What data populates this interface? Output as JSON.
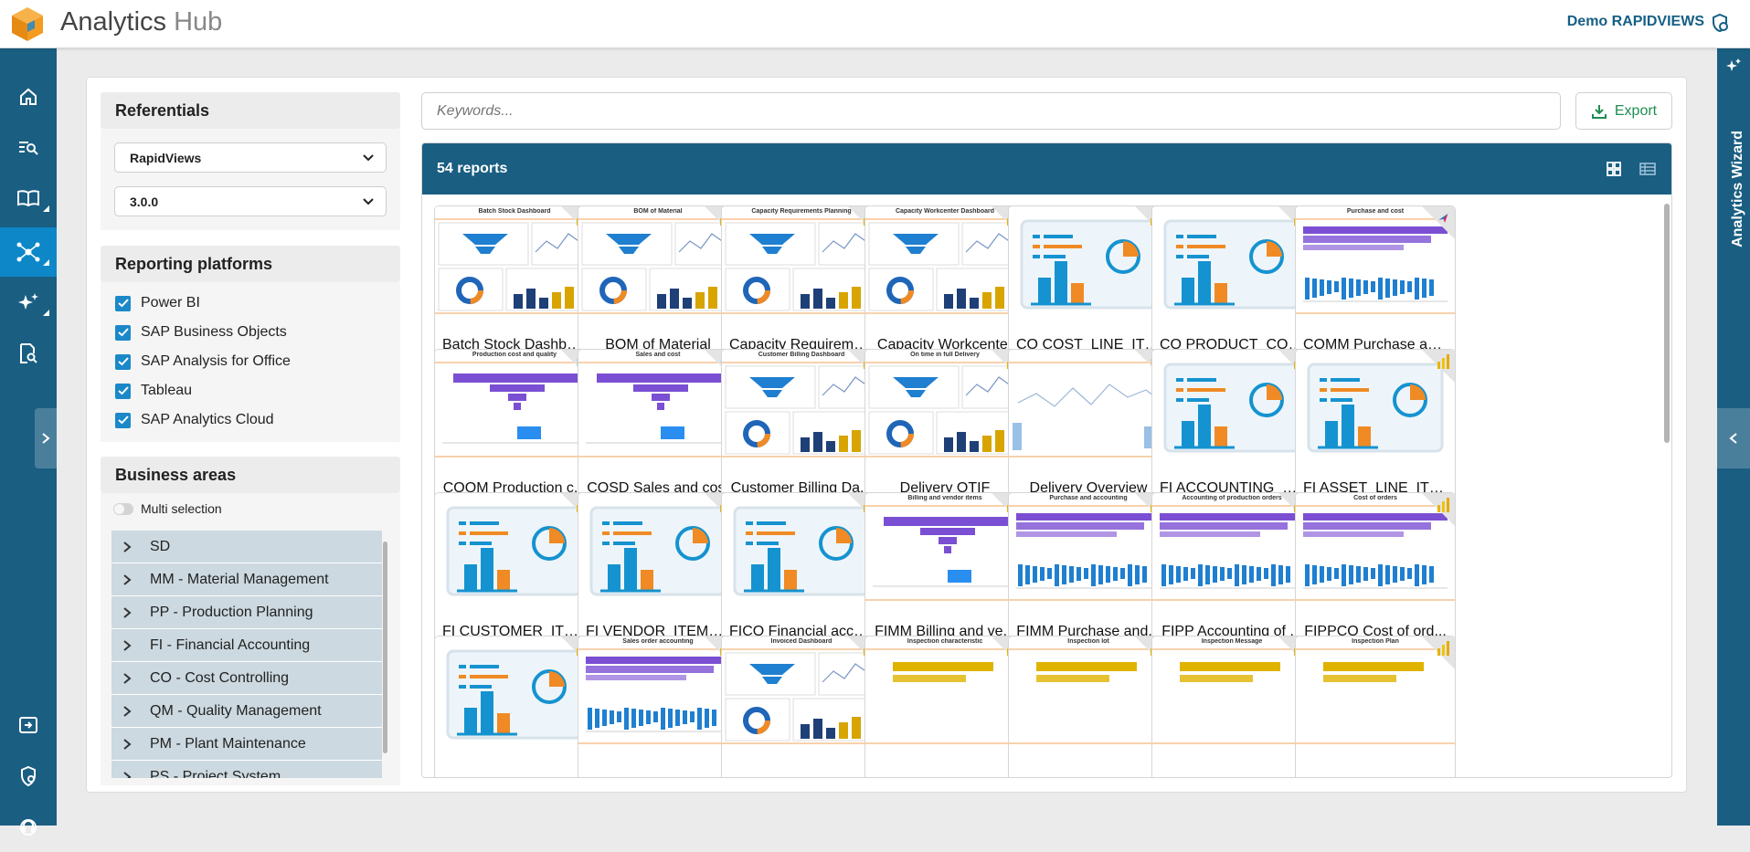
{
  "app": {
    "title_main": "Analytics",
    "title_sub": "Hub",
    "user": "Demo RAPIDVIEWS",
    "wizard": "Analytics Wizard"
  },
  "nav": {
    "items": [
      "home-icon",
      "search-list-icon",
      "book-icon",
      "network-icon",
      "sparkle-icon",
      "report-search-icon"
    ],
    "bottom": [
      "import-icon",
      "settings-icon",
      "support-icon"
    ],
    "active": "network-icon"
  },
  "referentials": {
    "title": "Referentials",
    "source": "RapidViews",
    "version": "3.0.0"
  },
  "platforms": {
    "title": "Reporting platforms",
    "items": [
      {
        "label": "Power BI",
        "checked": true
      },
      {
        "label": "SAP Business Objects",
        "checked": true
      },
      {
        "label": "SAP Analysis for Office",
        "checked": true
      },
      {
        "label": "Tableau",
        "checked": true
      },
      {
        "label": "SAP Analytics Cloud",
        "checked": true
      }
    ]
  },
  "areas": {
    "title": "Business areas",
    "multi": "Multi selection",
    "items": [
      "SD",
      "MM - Material Management",
      "PP - Production Planning",
      "FI - Financial Accounting",
      "CO - Cost Controlling",
      "QM - Quality Management",
      "PM - Plant Maintenance",
      "PS - Project System"
    ]
  },
  "search": {
    "placeholder": "Keywords..."
  },
  "export": {
    "label": "Export"
  },
  "results": {
    "count": "54 reports"
  },
  "colors": {
    "brand": "#1a5e82",
    "active": "#0d87c7",
    "export_green": "#1f8c52"
  },
  "reports": [
    {
      "title": "Batch Stock Dashbo...",
      "header": "Batch Stock Dashboard",
      "kind": "dash",
      "platform": "powerbi"
    },
    {
      "title": "BOM of Material",
      "header": "BOM of Material",
      "kind": "dash",
      "platform": "powerbi"
    },
    {
      "title": "Capacity Requireme...",
      "header": "Capacity Requirements Planning",
      "kind": "dash",
      "platform": "powerbi"
    },
    {
      "title": "Capacity Workcenter",
      "header": "Capacity Workcenter Dashboard",
      "kind": "dash",
      "platform": "powerbi"
    },
    {
      "title": "CO COST_LINE_ITEM",
      "header": "",
      "kind": "placeholder",
      "platform": "powerbi"
    },
    {
      "title": "CO PRODUCT_COST...",
      "header": "",
      "kind": "placeholder",
      "platform": "powerbi"
    },
    {
      "title": "COMM Purchase an...",
      "header": "Purchase and cost",
      "kind": "bars",
      "platform": "sac"
    },
    {
      "title": "COQM Production c...",
      "header": "Production cost and quality",
      "kind": "funnel",
      "platform": "ao"
    },
    {
      "title": "COSD Sales and cost",
      "header": "Sales and cost",
      "kind": "funnel",
      "platform": "tableau"
    },
    {
      "title": "Customer Billing Da...",
      "header": "Customer Billing Dashboard",
      "kind": "dash",
      "platform": "powerbi"
    },
    {
      "title": "Delivery OTIF",
      "header": "On time in full Delivery",
      "kind": "dash",
      "platform": "powerbi"
    },
    {
      "title": "Delivery Overview",
      "header": "",
      "kind": "line",
      "platform": "sap"
    },
    {
      "title": "FI ACCOUNTING_D...",
      "header": "",
      "kind": "placeholder",
      "platform": "powerbi"
    },
    {
      "title": "FI ASSET_LINE_ITE...",
      "header": "",
      "kind": "placeholder",
      "platform": "powerbi"
    },
    {
      "title": "FI CUSTOMER_ITEM...",
      "header": "",
      "kind": "placeholder",
      "platform": "powerbi"
    },
    {
      "title": "FI VENDOR_ITEMS_...",
      "header": "",
      "kind": "placeholder",
      "platform": "powerbi"
    },
    {
      "title": "FICO Financial acco...",
      "header": "",
      "kind": "placeholder",
      "platform": "powerbi"
    },
    {
      "title": "FIMM Billing and ve...",
      "header": "Billing and vendor items",
      "kind": "funnel",
      "platform": "powerbi"
    },
    {
      "title": "FIMM Purchase and...",
      "header": "Purchase and accounting",
      "kind": "bars",
      "platform": "powerbi"
    },
    {
      "title": "FIPP Accounting of ...",
      "header": "Accounting of production orders",
      "kind": "bars",
      "platform": "powerbi"
    },
    {
      "title": "FIPPCO Cost of ord...",
      "header": "Cost of orders",
      "kind": "bars",
      "platform": "powerbi"
    },
    {
      "title": "",
      "header": "",
      "kind": "placeholder",
      "platform": "powerbi"
    },
    {
      "title": "",
      "header": "Sales order accounting",
      "kind": "bars",
      "platform": "powerbi"
    },
    {
      "title": "",
      "header": "Invoiced Dashboard",
      "kind": "dash",
      "platform": "powerbi"
    },
    {
      "title": "",
      "header": "Inspection characteristic",
      "kind": "yellow",
      "platform": "powerbi"
    },
    {
      "title": "",
      "header": "Inspection lot",
      "kind": "yellow",
      "platform": "powerbi"
    },
    {
      "title": "",
      "header": "Inspection Message",
      "kind": "yellow",
      "platform": "powerbi"
    },
    {
      "title": "",
      "header": "Inspection Plan",
      "kind": "yellow",
      "platform": "powerbi"
    }
  ]
}
